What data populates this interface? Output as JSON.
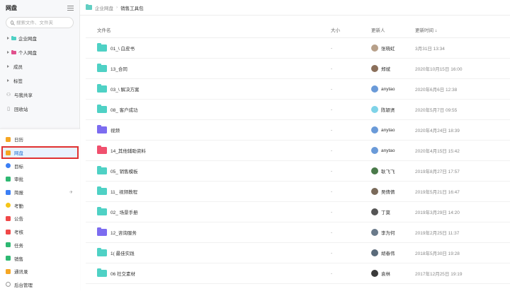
{
  "colors": {
    "folder_teal": "#4fd1c5",
    "folder_purple": "#7c6cf0",
    "folder_red": "#f0506e",
    "active_outline": "#e03131",
    "active_text": "#1f6fd1"
  },
  "sidebar": {
    "title": "网盘",
    "search_placeholder": "搜索文件、文件夹",
    "tree": [
      {
        "label": "企业网盘",
        "icon": "folder-teal-icon",
        "has_caret": true,
        "color": "#4fd1c5"
      },
      {
        "label": "个人网盘",
        "icon": "folder-pink-icon",
        "has_caret": true,
        "color": "#e0508c"
      },
      {
        "label": "成员",
        "icon": "",
        "has_caret": true
      },
      {
        "label": "标签",
        "icon": "",
        "has_caret": true
      },
      {
        "label": "与我共享",
        "icon": "share-icon",
        "has_caret": false
      },
      {
        "label": "回收站",
        "icon": "trash-icon",
        "has_caret": false
      }
    ]
  },
  "nav": [
    {
      "label": "日历",
      "icon": "calendar-icon",
      "color": "#f5a623"
    },
    {
      "label": "网盘",
      "icon": "cloud-drive-icon",
      "color": "#f5a623",
      "active": true
    },
    {
      "label": "目标",
      "icon": "target-icon",
      "color": "#3b7ff5"
    },
    {
      "label": "审批",
      "icon": "approval-icon",
      "color": "#2eb872"
    },
    {
      "label": "简报",
      "icon": "report-icon",
      "color": "#3b7ff5",
      "pin": true
    },
    {
      "label": "考勤",
      "icon": "attendance-icon",
      "color": "#f5c518"
    },
    {
      "label": "公告",
      "icon": "announcement-icon",
      "color": "#f04848"
    },
    {
      "label": "考核",
      "icon": "assessment-icon",
      "color": "#f04848"
    },
    {
      "label": "任务",
      "icon": "task-icon",
      "color": "#2eb872"
    },
    {
      "label": "销售",
      "icon": "sales-icon",
      "color": "#2eb872"
    },
    {
      "label": "通讯录",
      "icon": "contacts-icon",
      "color": "#f5a623"
    },
    {
      "label": "后台管理",
      "icon": "admin-icon",
      "color": "#999999"
    }
  ],
  "breadcrumb": {
    "root": "企业网盘",
    "separator": "›",
    "current": "销售工具包"
  },
  "table": {
    "headers": {
      "name": "文件名",
      "size": "大小",
      "user": "更新人",
      "time": "更新时间",
      "sort_icon": "↓"
    },
    "rows": [
      {
        "name": "01_\\         白皮书",
        "size": "-",
        "user": "张晓虹",
        "time": "3月31日 13:34",
        "folder_color": "#4fd1c5",
        "avatar_color": "#b7a08a"
      },
      {
        "name": "13_合同",
        "size": "-",
        "user": "郑斌",
        "time": "2020年10月15日 16:00",
        "folder_color": "#4fd1c5",
        "avatar_color": "#8a6f5a"
      },
      {
        "name": "03_\\         解决方案",
        "size": "-",
        "user": "anytao",
        "time": "2020年6月6日 12:38",
        "folder_color": "#4fd1c5",
        "avatar_color": "#6a9ad8"
      },
      {
        "name": "08_           客户成功",
        "size": "-",
        "user": "陈颖贤",
        "time": "2020年5月7日 09:55",
        "folder_color": "#4fd1c5",
        "avatar_color": "#7fd3e8"
      },
      {
        "name": "视频",
        "size": "-",
        "user": "anytao",
        "time": "2020年4月24日 18:39",
        "folder_color": "#7c6cf0",
        "avatar_color": "#6a9ad8"
      },
      {
        "name": "14_其他辅助资料",
        "size": "-",
        "user": "anytao",
        "time": "2020年4月15日 15:42",
        "folder_color": "#f0506e",
        "avatar_color": "#6a9ad8"
      },
      {
        "name": "05_           销售模板",
        "size": "-",
        "user": "耿飞飞",
        "time": "2019年8月27日 17:57",
        "folder_color": "#4fd1c5",
        "avatar_color": "#4a7a4a"
      },
      {
        "name": "11_           视频教程",
        "size": "-",
        "user": "吴倩倩",
        "time": "2019年5月21日 16:47",
        "folder_color": "#4fd1c5",
        "avatar_color": "#7a6a5a"
      },
      {
        "name": "02_           场景手册",
        "size": "-",
        "user": "丁莫",
        "time": "2019年3月29日 14:20",
        "folder_color": "#4fd1c5",
        "avatar_color": "#555555"
      },
      {
        "name": "12_咨询服务",
        "size": "-",
        "user": "李为何",
        "time": "2019年2月25日 11:37",
        "folder_color": "#7c6cf0",
        "avatar_color": "#6a7a8a"
      },
      {
        "name": "1(           最佳实践",
        "size": "-",
        "user": "胡春伟",
        "time": "2018年5月30日 19:28",
        "folder_color": "#4fd1c5",
        "avatar_color": "#5a6a7a"
      },
      {
        "name": "06           社交素材",
        "size": "-",
        "user": "袁林",
        "time": "2017年12月25日 19:19",
        "folder_color": "#4fd1c5",
        "avatar_color": "#3a3a3a"
      }
    ]
  }
}
